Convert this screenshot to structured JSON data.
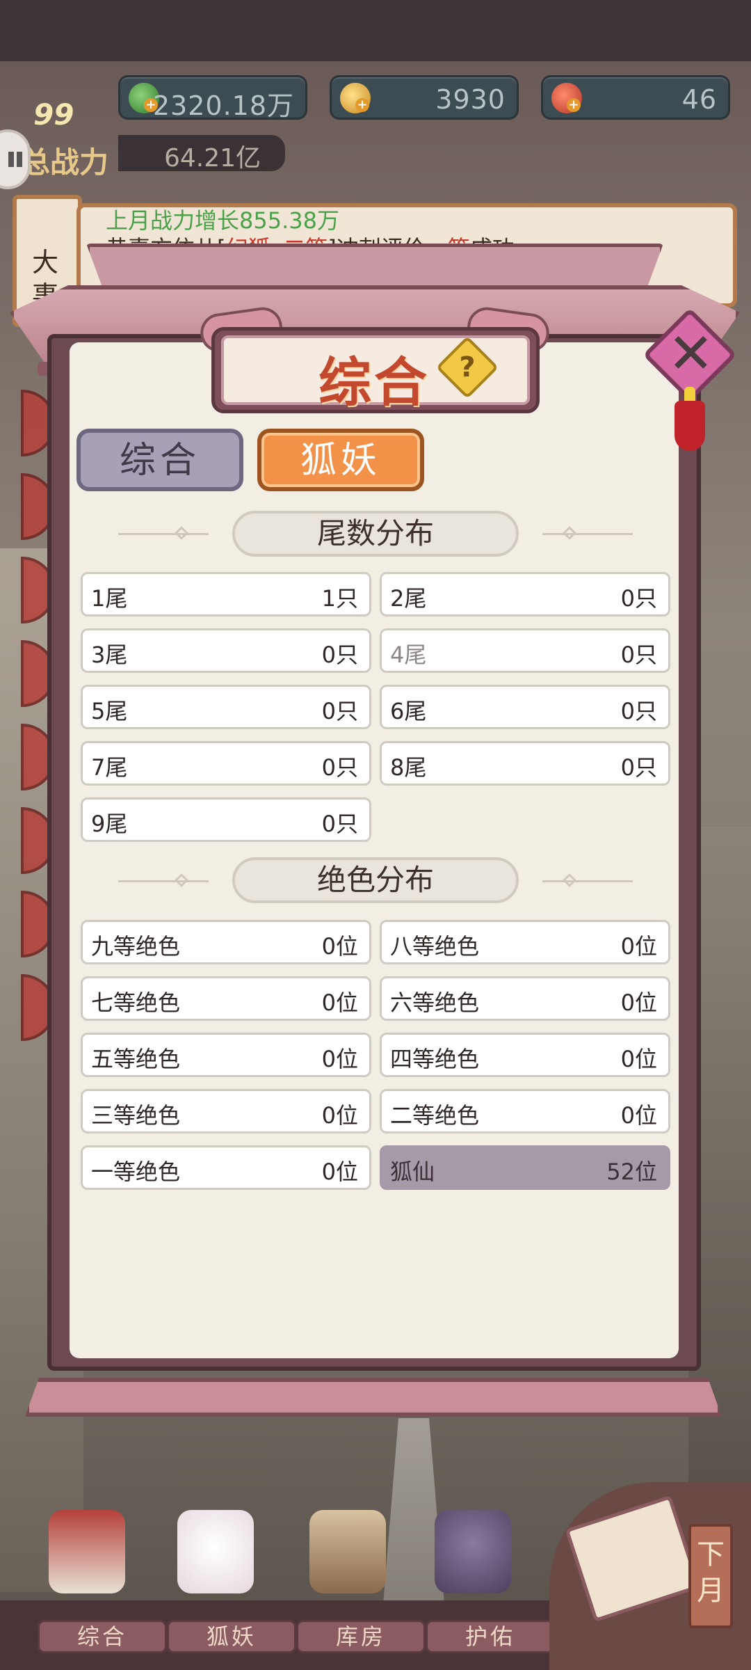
{
  "resources": {
    "jade": "2320.18万",
    "gold": "3930",
    "fruit": "46"
  },
  "player": {
    "level": "99",
    "power_label": "总战力",
    "power_value": "64.21亿"
  },
  "event_board": {
    "tag_chars": [
      "大",
      "事"
    ],
    "green_line": "上月战力增长855.38万",
    "line_prefix": "恭喜方依儿[",
    "line_red1": "幻狐",
    "line_dot": "•",
    "line_red2": "二等",
    "line_mid": "]冲刺评价",
    "line_red3": "一等",
    "line_suffix": "成功"
  },
  "dialog": {
    "title": "综合",
    "help": "?",
    "close": "✕",
    "tabs": [
      "综合",
      "狐妖"
    ],
    "active_tab": "狐妖"
  },
  "tail_section": {
    "title": "尾数分布",
    "items": [
      {
        "label": "1尾",
        "value": "1只"
      },
      {
        "label": "2尾",
        "value": "0只"
      },
      {
        "label": "3尾",
        "value": "0只"
      },
      {
        "label": "4尾",
        "value": "0只"
      },
      {
        "label": "5尾",
        "value": "0只"
      },
      {
        "label": "6尾",
        "value": "0只"
      },
      {
        "label": "7尾",
        "value": "0只"
      },
      {
        "label": "8尾",
        "value": "0只"
      },
      {
        "label": "9尾",
        "value": "0只"
      }
    ]
  },
  "beauty_section": {
    "title": "绝色分布",
    "items": [
      {
        "label": "九等绝色",
        "value": "0位"
      },
      {
        "label": "八等绝色",
        "value": "0位"
      },
      {
        "label": "七等绝色",
        "value": "0位"
      },
      {
        "label": "六等绝色",
        "value": "0位"
      },
      {
        "label": "五等绝色",
        "value": "0位"
      },
      {
        "label": "四等绝色",
        "value": "0位"
      },
      {
        "label": "三等绝色",
        "value": "0位"
      },
      {
        "label": "二等绝色",
        "value": "0位"
      },
      {
        "label": "一等绝色",
        "value": "0位"
      },
      {
        "label": "狐仙",
        "value": "52位"
      }
    ]
  },
  "bottom_nav": [
    "综合",
    "狐妖",
    "库房",
    "护佑"
  ],
  "next_month": "下月",
  "colors": {
    "tab_active": "#f29148",
    "tab_inactive": "#a8a0b6",
    "title_red": "#c2482e",
    "highlight_cell": "#a79aa8"
  }
}
